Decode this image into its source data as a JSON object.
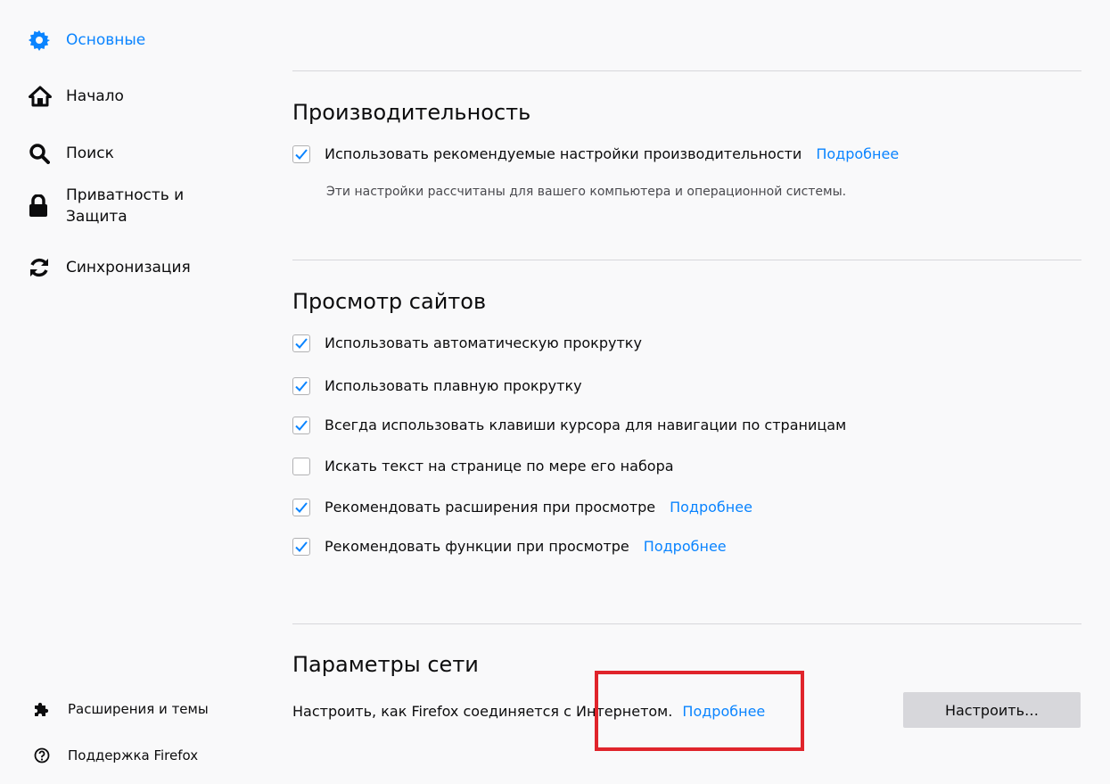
{
  "sidebar": {
    "items": [
      {
        "label": "Основные",
        "icon": "gear-icon",
        "active": true
      },
      {
        "label": "Начало",
        "icon": "home-icon"
      },
      {
        "label": "Поиск",
        "icon": "search-icon"
      },
      {
        "label": "Приватность и\nЗащита",
        "icon": "lock-icon"
      },
      {
        "label": "Синхронизация",
        "icon": "sync-icon"
      }
    ],
    "footer": [
      {
        "label": "Расширения и темы",
        "icon": "puzzle-icon"
      },
      {
        "label": "Поддержка Firefox",
        "icon": "help-icon"
      }
    ]
  },
  "performance": {
    "title": "Производительность",
    "use_recommended": {
      "label": "Использовать рекомендуемые настройки производительности",
      "checked": true,
      "link": "Подробнее"
    },
    "description": "Эти настройки рассчитаны для вашего компьютера и операционной системы."
  },
  "browsing": {
    "title": "Просмотр сайтов",
    "options": [
      {
        "label": "Использовать автоматическую прокрутку",
        "checked": true
      },
      {
        "label": "Использовать плавную прокрутку",
        "checked": true
      },
      {
        "label": "Всегда использовать клавиши курсора для навигации по страницам",
        "checked": true
      },
      {
        "label": "Искать текст на странице по мере его набора",
        "checked": false
      },
      {
        "label": "Рекомендовать расширения при просмотре",
        "checked": true,
        "link": "Подробнее"
      },
      {
        "label": "Рекомендовать функции при просмотре",
        "checked": true,
        "link": "Подробнее"
      }
    ]
  },
  "network": {
    "title": "Параметры сети",
    "description": "Настроить, как Firefox соединяется с Интернетом.",
    "link": "Подробнее",
    "button": "Настроить…"
  },
  "colors": {
    "accent": "#0a84ff",
    "highlight": "#e0242b"
  }
}
